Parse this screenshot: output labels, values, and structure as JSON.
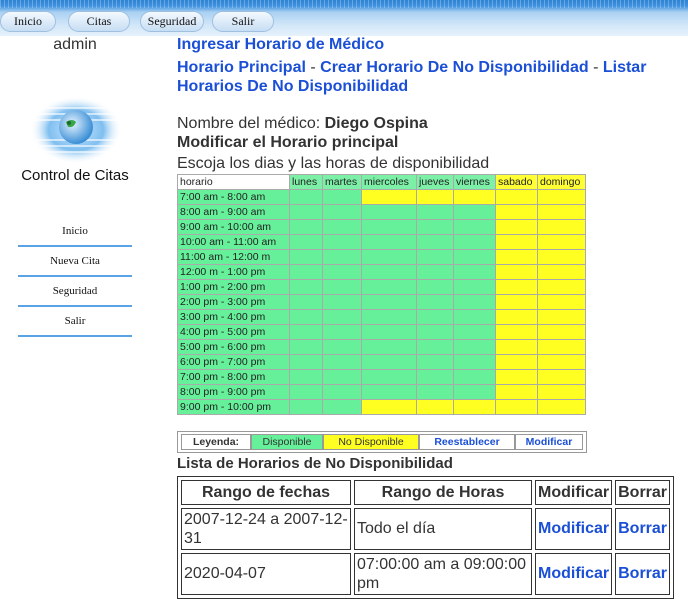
{
  "topnav": {
    "items": [
      "Inicio",
      "Citas",
      "Seguridad",
      "Salir"
    ]
  },
  "sidebar": {
    "user": "admin",
    "app_title": "Control de Citas",
    "nav": [
      "Inicio",
      "Nueva Cita",
      "Seguridad",
      "Salir"
    ]
  },
  "page": {
    "title": "Ingresar Horario de Médico",
    "link_horario_principal": "Horario Principal",
    "link_crear": "Crear Horario De No Disponibilidad",
    "link_listar": "Listar Horarios De No Disponibilidad",
    "separator": " - ",
    "doctor_label": "Nombre del médico:",
    "doctor_name": "Diego Ospina",
    "subheading": "Modificar el Horario principal",
    "instructions": "Escoja los dias y las horas de disponibilidad"
  },
  "schedule": {
    "days": [
      "horario",
      "lunes",
      "martes",
      "miercoles",
      "jueves",
      "viernes",
      "sabado",
      "domingo"
    ],
    "times": [
      "7:00 am - 8:00 am",
      "8:00 am - 9:00 am",
      "9:00 am - 10:00 am",
      "10:00 am - 11:00 am",
      "11:00 am - 12:00 m",
      "12:00 m - 1:00 pm",
      "1:00 pm - 2:00 pm",
      "2:00 pm - 3:00 pm",
      "3:00 pm - 4:00 pm",
      "4:00 pm - 5:00 pm",
      "5:00 pm - 6:00 pm",
      "6:00 pm - 7:00 pm",
      "7:00 pm - 8:00 pm",
      "8:00 pm - 9:00 pm",
      "9:00 pm - 10:00 pm"
    ],
    "availability": [
      [
        1,
        1,
        0,
        0,
        0,
        0,
        0
      ],
      [
        1,
        1,
        1,
        1,
        1,
        0,
        0
      ],
      [
        1,
        1,
        1,
        1,
        1,
        0,
        0
      ],
      [
        1,
        1,
        1,
        1,
        1,
        0,
        0
      ],
      [
        1,
        1,
        1,
        1,
        1,
        0,
        0
      ],
      [
        1,
        1,
        1,
        1,
        1,
        0,
        0
      ],
      [
        1,
        1,
        1,
        1,
        1,
        0,
        0
      ],
      [
        1,
        1,
        1,
        1,
        1,
        0,
        0
      ],
      [
        1,
        1,
        1,
        1,
        1,
        0,
        0
      ],
      [
        1,
        1,
        1,
        1,
        1,
        0,
        0
      ],
      [
        1,
        1,
        1,
        1,
        1,
        0,
        0
      ],
      [
        1,
        1,
        1,
        1,
        1,
        0,
        0
      ],
      [
        1,
        1,
        1,
        1,
        1,
        0,
        0
      ],
      [
        1,
        1,
        1,
        1,
        1,
        0,
        0
      ],
      [
        1,
        1,
        0,
        0,
        0,
        0,
        0
      ]
    ],
    "colors": {
      "available": "#66f09a",
      "unavailable": "#ffff22"
    }
  },
  "legend": {
    "label": "Leyenda:",
    "available": "Disponible",
    "unavailable": "No Disponible",
    "reset_button": "Reestablecer",
    "modify_button": "Modificar"
  },
  "unavailability": {
    "title": "Lista de Horarios de No Disponibilidad",
    "headers": [
      "Rango de fechas",
      "Rango de Horas",
      "Modificar",
      "Borrar"
    ],
    "rows": [
      {
        "dates": "2007-12-24 a 2007-12-31",
        "hours": "Todo el día",
        "modify": "Modificar",
        "delete": "Borrar"
      },
      {
        "dates": "2020-04-07",
        "hours": "07:00:00 am a 09:00:00 pm",
        "modify": "Modificar",
        "delete": "Borrar"
      }
    ]
  }
}
